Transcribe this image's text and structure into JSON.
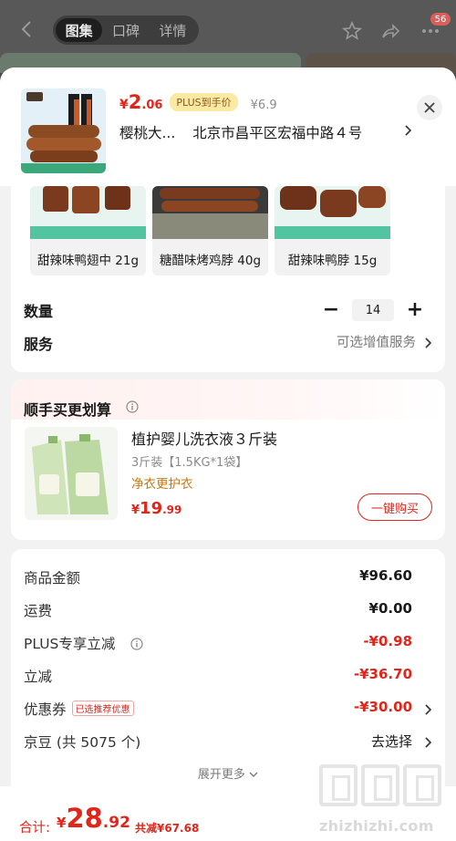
{
  "top_tabs": [
    "图集",
    "口碑",
    "详情"
  ],
  "cart_count": "56",
  "header": {
    "currency": "¥",
    "price_int": "2",
    "price_dec": ".06",
    "plus_badge": "PLUS到手价",
    "original_price": "¥6.9",
    "shop_short": "樱桃大...",
    "address": "北京市昌平区宏福中路４号"
  },
  "variants": [
    {
      "label": "甜辣味鸭翅中 21g"
    },
    {
      "label": "糖醋味烤鸡脖 40g"
    },
    {
      "label": "甜辣味鸭脖 15g"
    }
  ],
  "quantity": {
    "label": "数量",
    "value": "14",
    "minus": "−",
    "plus": "+"
  },
  "service": {
    "label": "服务",
    "value": "可选增值服务"
  },
  "upsell": {
    "title": "顺手买更划算",
    "name": "植护婴儿洗衣液３斤装",
    "spec": "3斤装【1.5KG*1袋】",
    "tag": "净衣更护衣",
    "currency": "¥",
    "price_int": "19",
    "price_dec": ".99",
    "button": "一键购买"
  },
  "summary": {
    "rows": [
      {
        "label": "商品金额",
        "value": "¥96.60"
      },
      {
        "label": "运费",
        "value": "¥0.00"
      },
      {
        "label": "PLUS专享立减",
        "value": "-¥0.98"
      },
      {
        "label": "立减",
        "value": "-¥36.70"
      },
      {
        "label": "优惠券",
        "badge": "已选推荐优惠",
        "value": "-¥30.00"
      },
      {
        "label": "京豆 (共 5075 个)",
        "value": "去选择"
      }
    ],
    "expand": "展开更多"
  },
  "bottom": {
    "total_label": "合计:",
    "currency": "¥",
    "total_int": "28",
    "total_dec": ".92",
    "discount": "共减¥67.68"
  },
  "watermark": "zhizhizhi.com",
  "colors": {
    "accent": "#e1251b",
    "plus_badge_bg": "#fbe9a5"
  }
}
